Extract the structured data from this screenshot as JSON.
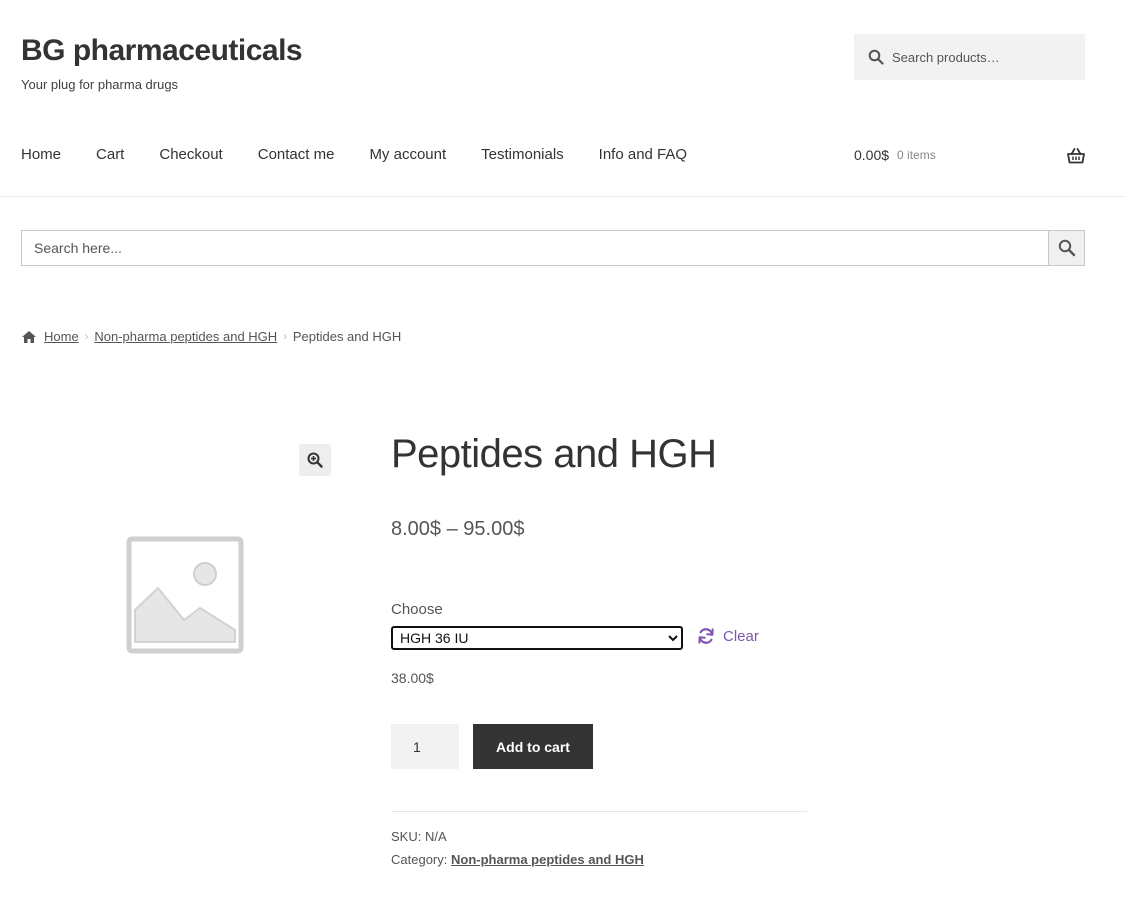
{
  "site": {
    "title": "BG pharmaceuticals",
    "tagline": "Your plug for pharma drugs"
  },
  "header_search": {
    "placeholder": "Search products…",
    "icon": "search-icon"
  },
  "nav": {
    "items": [
      "Home",
      "Cart",
      "Checkout",
      "Contact me",
      "My account",
      "Testimonials",
      "Info and FAQ"
    ]
  },
  "cart": {
    "amount": "0.00$",
    "items": "0 items",
    "icon": "basket-icon"
  },
  "wide_search": {
    "placeholder": "Search here...",
    "icon": "search-icon"
  },
  "breadcrumb": {
    "home": "Home",
    "category": "Non-pharma peptides and HGH",
    "current": "Peptides and HGH"
  },
  "product": {
    "title": "Peptides and HGH",
    "price_range": "8.00$ – 95.00$",
    "choose_label": "Choose",
    "selected_option": "HGH 36 IU",
    "clear_label": "Clear",
    "variation_price": "38.00$",
    "quantity": "1",
    "add_to_cart_label": "Add to cart",
    "sku": "SKU: N/A",
    "category_label": "Category:",
    "category_link": "Non-pharma peptides and HGH"
  },
  "colors": {
    "accent": "#7f54b3",
    "button_dark": "#333333"
  }
}
